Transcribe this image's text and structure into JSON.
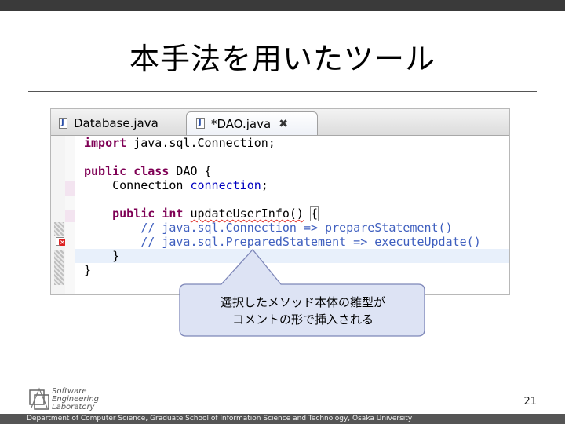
{
  "slide": {
    "title": "本手法を用いたツール",
    "page_number": "21",
    "footer": "Department of Computer Science, Graduate School of Information Science and Technology, Osaka University",
    "logo_lines": [
      "Software",
      "Engineering",
      "Laboratory"
    ]
  },
  "editor": {
    "tabs": [
      {
        "label": "Database.java",
        "icon": "java-file-icon",
        "active": false
      },
      {
        "label": "*DAO.java",
        "icon": "java-file-icon",
        "active": true,
        "close": "✖"
      }
    ],
    "code_lines": [
      {
        "tokens": [
          {
            "t": "import",
            "c": "kw"
          },
          {
            "t": " java.sql.Connection;",
            "c": ""
          }
        ]
      },
      {
        "tokens": []
      },
      {
        "tokens": [
          {
            "t": "public",
            "c": "kw"
          },
          {
            "t": " ",
            "c": ""
          },
          {
            "t": "class",
            "c": "kw"
          },
          {
            "t": " DAO {",
            "c": ""
          }
        ]
      },
      {
        "tokens": [
          {
            "t": "    Connection ",
            "c": ""
          },
          {
            "t": "connection",
            "c": "field"
          },
          {
            "t": ";",
            "c": ""
          }
        ]
      },
      {
        "tokens": []
      },
      {
        "tokens": [
          {
            "t": "    ",
            "c": ""
          },
          {
            "t": "public",
            "c": "kw"
          },
          {
            "t": " ",
            "c": ""
          },
          {
            "t": "int",
            "c": "kw"
          },
          {
            "t": " ",
            "c": ""
          },
          {
            "t": "updateUserInfo()",
            "c": "err"
          },
          {
            "t": " ",
            "c": ""
          },
          {
            "t": "{",
            "c": "br"
          }
        ]
      },
      {
        "tokens": [
          {
            "t": "        // java.sql.Connection => prepareStatement()",
            "c": "cm"
          }
        ]
      },
      {
        "tokens": [
          {
            "t": "        // java.sql.PreparedStatement => executeUpdate()",
            "c": "cm"
          }
        ]
      },
      {
        "tokens": [
          {
            "t": "    }",
            "c": ""
          }
        ],
        "highlight": true
      },
      {
        "tokens": [
          {
            "t": "}",
            "c": ""
          }
        ]
      }
    ]
  },
  "callout": {
    "lines": [
      "選択したメソッド本体の雛型が",
      "コメントの形で挿入される"
    ]
  },
  "colors": {
    "keyword": "#7f0055",
    "field": "#0000c0",
    "comment": "#3f5fbf",
    "callout_fill": "#dde3f4",
    "callout_stroke": "#7d86b8"
  }
}
